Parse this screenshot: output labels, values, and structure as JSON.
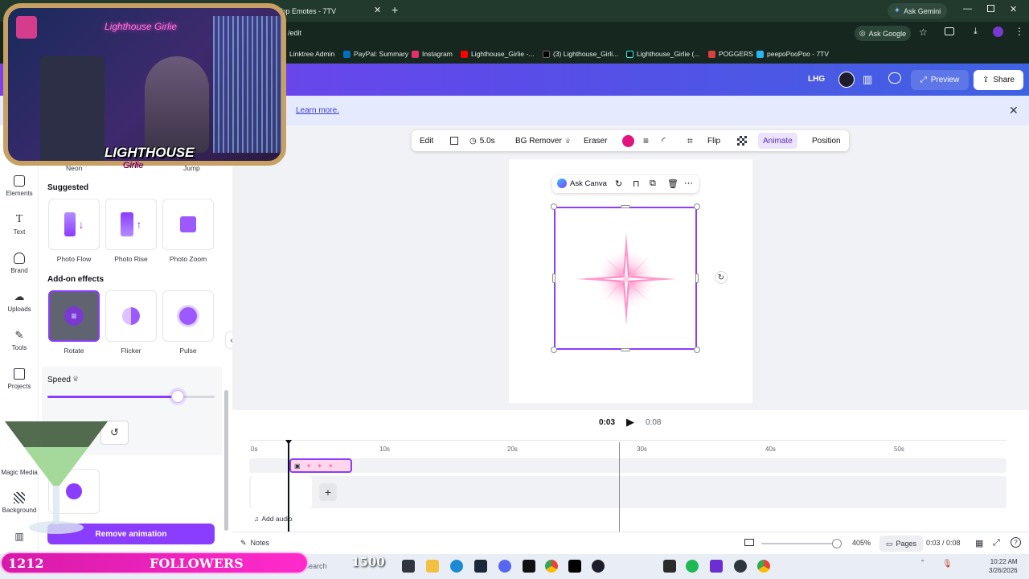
{
  "browser": {
    "tab_title": "Top Emotes - 7TV",
    "ask_gemini": "Ask Gemini",
    "url_fragment": "/edit",
    "ask_google": "Ask Google",
    "bookmarks": [
      "Linktree Admin",
      "PayPal: Summary",
      "Instagram",
      "Lighthouse_Girlie -...",
      "(3) Lighthouse_Girli...",
      "Lighthouse_Girlie (...",
      "POGGERS",
      "peepoPooPoo - 7TV"
    ]
  },
  "header": {
    "user_initials": "LHG",
    "preview_label": "Preview",
    "share_label": "Share"
  },
  "banner": {
    "learn_more": "Learn more."
  },
  "rail": {
    "items": [
      "Elements",
      "Text",
      "Brand",
      "Uploads",
      "Tools",
      "Projects",
      "Magic Media",
      "Background"
    ]
  },
  "panel": {
    "top_labels": [
      "Neon",
      "Jump"
    ],
    "suggested_title": "Suggested",
    "suggested": [
      "Photo Flow",
      "Photo Rise",
      "Photo Zoom"
    ],
    "addon_title": "Add-on effects",
    "addons": [
      "Rotate",
      "Flicker",
      "Pulse"
    ],
    "speed_label": "Speed",
    "speed_value": 0.78,
    "remove_label": "Remove animation"
  },
  "toolbar": {
    "edit": "Edit",
    "duration": "5.0s",
    "bg_remover": "BG Remover",
    "eraser": "Eraser",
    "flip": "Flip",
    "animate": "Animate",
    "position": "Position",
    "color": "#e2137d"
  },
  "floatbar": {
    "ask_canva": "Ask Canva"
  },
  "playback": {
    "current": "0:03",
    "total": "0:08"
  },
  "timeline": {
    "ticks": [
      "0s",
      "10s",
      "20s",
      "30s",
      "40s",
      "50s"
    ],
    "add_audio": "Add audio"
  },
  "footer": {
    "notes": "Notes",
    "zoom": "405%",
    "pages": "Pages",
    "time": "0:03 / 0:08"
  },
  "taskbar": {
    "search": "Search",
    "time": "10:22 AM",
    "date": "3/26/2026"
  },
  "overlay": {
    "webcam_sign": "Lighthouse Girlie",
    "logo_line1": "LIGHTHOUSE",
    "logo_line2": "Girlie",
    "followers_count": "1212",
    "followers_label": "FOLLOWERS",
    "followers_goal": "1500"
  },
  "colors": {
    "brand_purple": "#8b3dff",
    "header_gradient_start": "#7b3ff2",
    "header_gradient_end": "#3e63e2"
  }
}
